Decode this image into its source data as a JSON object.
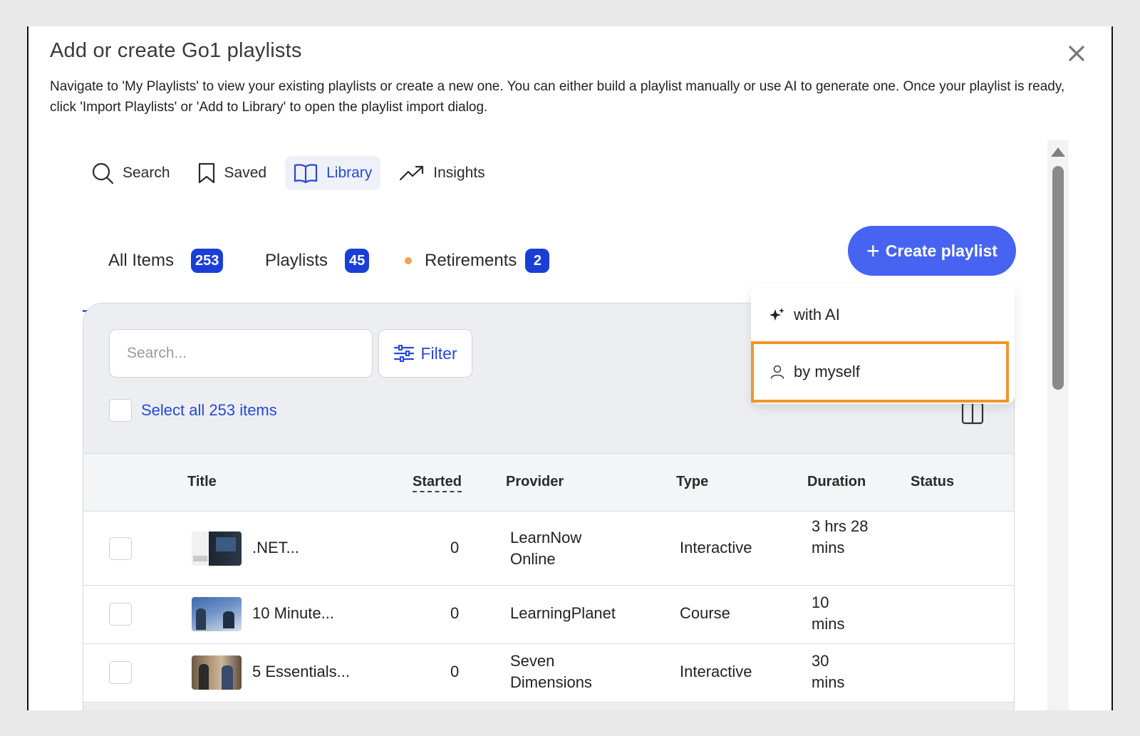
{
  "dialog": {
    "title": "Add or create Go1 playlists",
    "description": "Navigate to 'My Playlists' to view your existing playlists or create a new one. You can either build a playlist manually or use AI to generate one. Once your playlist is ready, click 'Import Playlists' or 'Add to Library' to open the playlist import dialog."
  },
  "nav": {
    "search": "Search",
    "saved": "Saved",
    "library": "Library",
    "insights": "Insights"
  },
  "tabs": {
    "all_items": {
      "label": "All Items",
      "count": "253"
    },
    "playlists": {
      "label": "Playlists",
      "count": "45"
    },
    "retirements": {
      "label": "Retirements",
      "count": "2"
    }
  },
  "create_playlist": {
    "label": "Create playlist",
    "menu": {
      "with_ai": "with AI",
      "by_myself": "by myself"
    }
  },
  "toolbar": {
    "search_placeholder": "Search...",
    "filter_label": "Filter",
    "select_all_label": "Select all 253 items"
  },
  "table": {
    "headers": {
      "title": "Title",
      "started": "Started",
      "provider": "Provider",
      "type": "Type",
      "duration": "Duration",
      "status": "Status"
    },
    "rows": [
      {
        "title": ".NET...",
        "started": "0",
        "provider": "LearnNow Online",
        "type": "Interactive",
        "duration": "3 hrs 28 mins",
        "status": ""
      },
      {
        "title": "10 Minute...",
        "started": "0",
        "provider": "LearningPlanet",
        "type": "Course",
        "duration": "10 mins",
        "status": ""
      },
      {
        "title": "5 Essentials...",
        "started": "0",
        "provider": "Seven Dimensions",
        "type": "Interactive",
        "duration": "30 mins",
        "status": ""
      }
    ]
  },
  "colors": {
    "accent": "#4663f2",
    "link": "#2748d8",
    "badge": "#1a3fd6",
    "highlight_outline": "#f0952a",
    "retirement_dot": "#f1a352",
    "panel": "#eceef1"
  },
  "icons": [
    "close-icon",
    "search-icon",
    "bookmark-icon",
    "book-open-icon",
    "trending-up-icon",
    "plus-icon",
    "sparkles-icon",
    "user-icon",
    "sliders-icon",
    "columns-icon"
  ]
}
